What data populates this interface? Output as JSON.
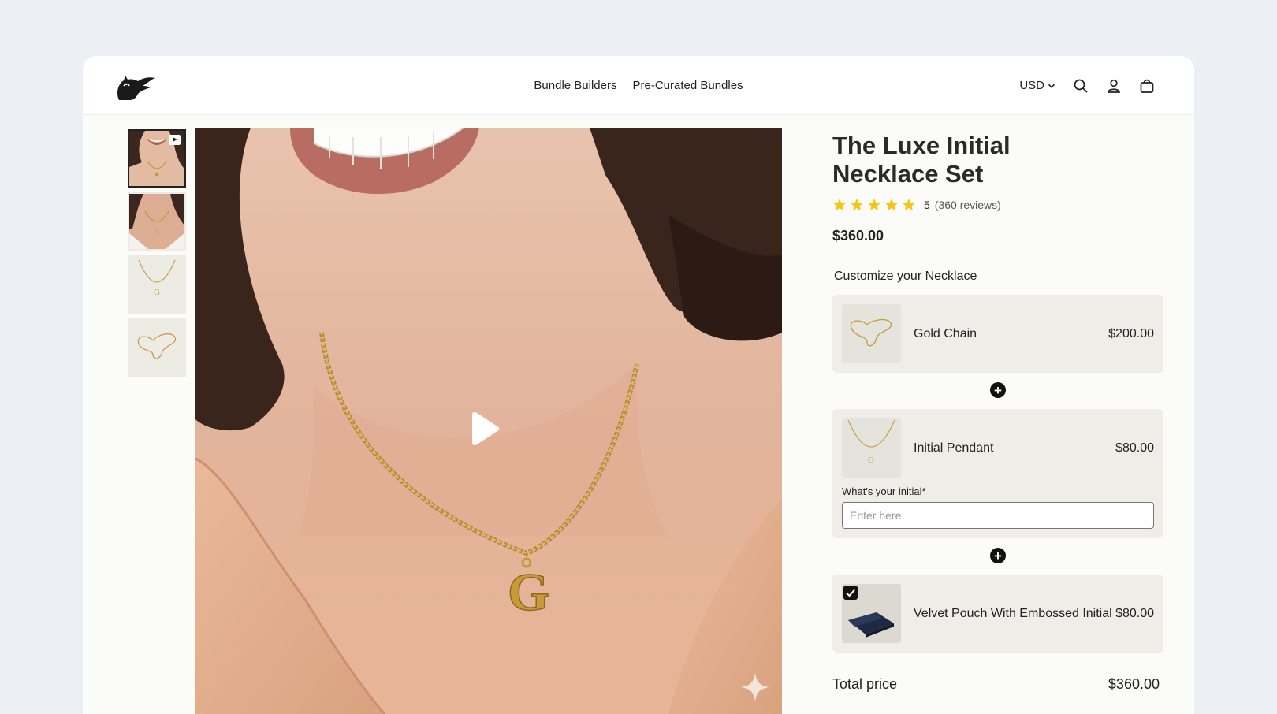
{
  "header": {
    "nav": [
      "Bundle Builders",
      "Pre-Curated Bundles"
    ],
    "currency": "USD"
  },
  "gallery": {
    "thumbnails": [
      "model-wearing-necklace-video",
      "model-neck-closeup",
      "pendant-on-white",
      "chain-on-white"
    ],
    "active_index": 0
  },
  "product": {
    "title": "The Luxe Initial Necklace Set",
    "rating_value": "5",
    "stars": 5,
    "reviews": "(360 reviews)",
    "price": "$360.00"
  },
  "customize": {
    "heading": "Customize your Necklace",
    "items": [
      {
        "name": "Gold Chain",
        "price": "$200.00"
      },
      {
        "name": "Initial Pendant",
        "price": "$80.00",
        "field_label": "What's your initial*",
        "field_placeholder": "Enter here"
      },
      {
        "name": "Velvet Pouch With Embossed Initial",
        "price": "$80.00",
        "checked": true
      }
    ]
  },
  "total": {
    "label": "Total price",
    "value": "$360.00"
  },
  "colors": {
    "star": "#f5c518",
    "background": "#eceff3",
    "panel": "#fbfbf7",
    "card": "#eeede7"
  }
}
